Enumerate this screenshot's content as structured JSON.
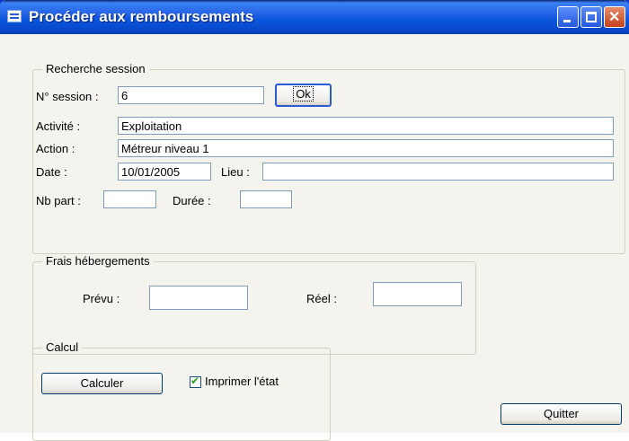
{
  "window": {
    "title": "Procéder aux remboursements"
  },
  "recherche": {
    "legend": "Recherche session",
    "session_label": "N° session :",
    "session_value": "6",
    "ok_label": "Ok",
    "activite_label": "Activité :",
    "activite_value": "Exploitation",
    "action_label": "Action :",
    "action_value": "Métreur niveau 1",
    "date_label": "Date :",
    "date_value": "10/01/2005",
    "lieu_label": "Lieu :",
    "lieu_value": "",
    "nbpart_label": "Nb part :",
    "nbpart_value": "",
    "duree_label": "Durée :",
    "duree_value": ""
  },
  "frais": {
    "legend": "Frais hébergements",
    "prevu_label": "Prévu :",
    "prevu_value": "",
    "reel_label": "Réel :",
    "reel_value": ""
  },
  "calcul": {
    "legend": "Calcul",
    "calculer_label": "Calculer",
    "imprimer_label": "Imprimer l'état",
    "imprimer_checked": true
  },
  "footer": {
    "quitter_label": "Quitter"
  },
  "colors": {
    "titlebar": "#0855dd",
    "frame": "#0831d9",
    "close": "#c5401a"
  }
}
